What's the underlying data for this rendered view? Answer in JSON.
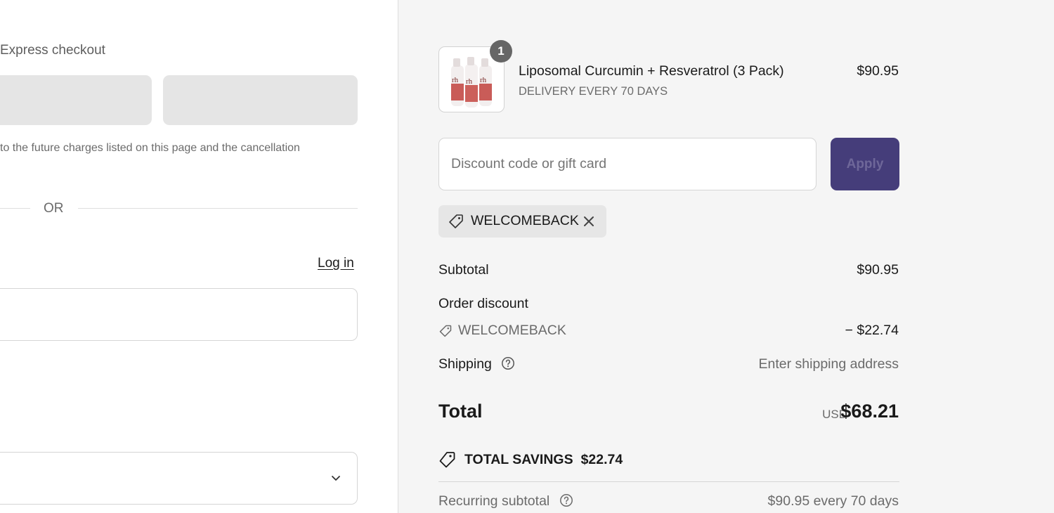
{
  "express": {
    "label": "Express checkout",
    "legal_text": "to the future charges listed on this page and the cancellation",
    "or_text": "OR"
  },
  "contact": {
    "login_label": "Log in"
  },
  "cart": {
    "product": {
      "title": "Liposomal Curcumin + Resveratrol (3 Pack)",
      "subtitle": "DELIVERY EVERY 70 DAYS",
      "price": "$90.95",
      "quantity": "1",
      "image_icon": "product-bottles-image"
    },
    "discount": {
      "placeholder": "Discount code or gift card",
      "apply_label": "Apply",
      "applied_code": "WELCOMEBACK"
    },
    "summary": {
      "subtotal_label": "Subtotal",
      "subtotal_value": "$90.95",
      "order_discount_label": "Order discount",
      "discount_code": "WELCOMEBACK",
      "discount_value": "− $22.74",
      "shipping_label": "Shipping",
      "shipping_value": "Enter shipping address",
      "total_label": "Total",
      "total_currency": "USD",
      "total_value": "$68.21",
      "savings_label": "TOTAL SAVINGS",
      "savings_value": "$22.74",
      "recurring_label": "Recurring subtotal",
      "recurring_value": "$90.95 every 70 days"
    }
  },
  "colors": {
    "apply_button": "#453d7a",
    "summary_background": "#f5f5f5",
    "express_button": "#e5e5e5"
  }
}
